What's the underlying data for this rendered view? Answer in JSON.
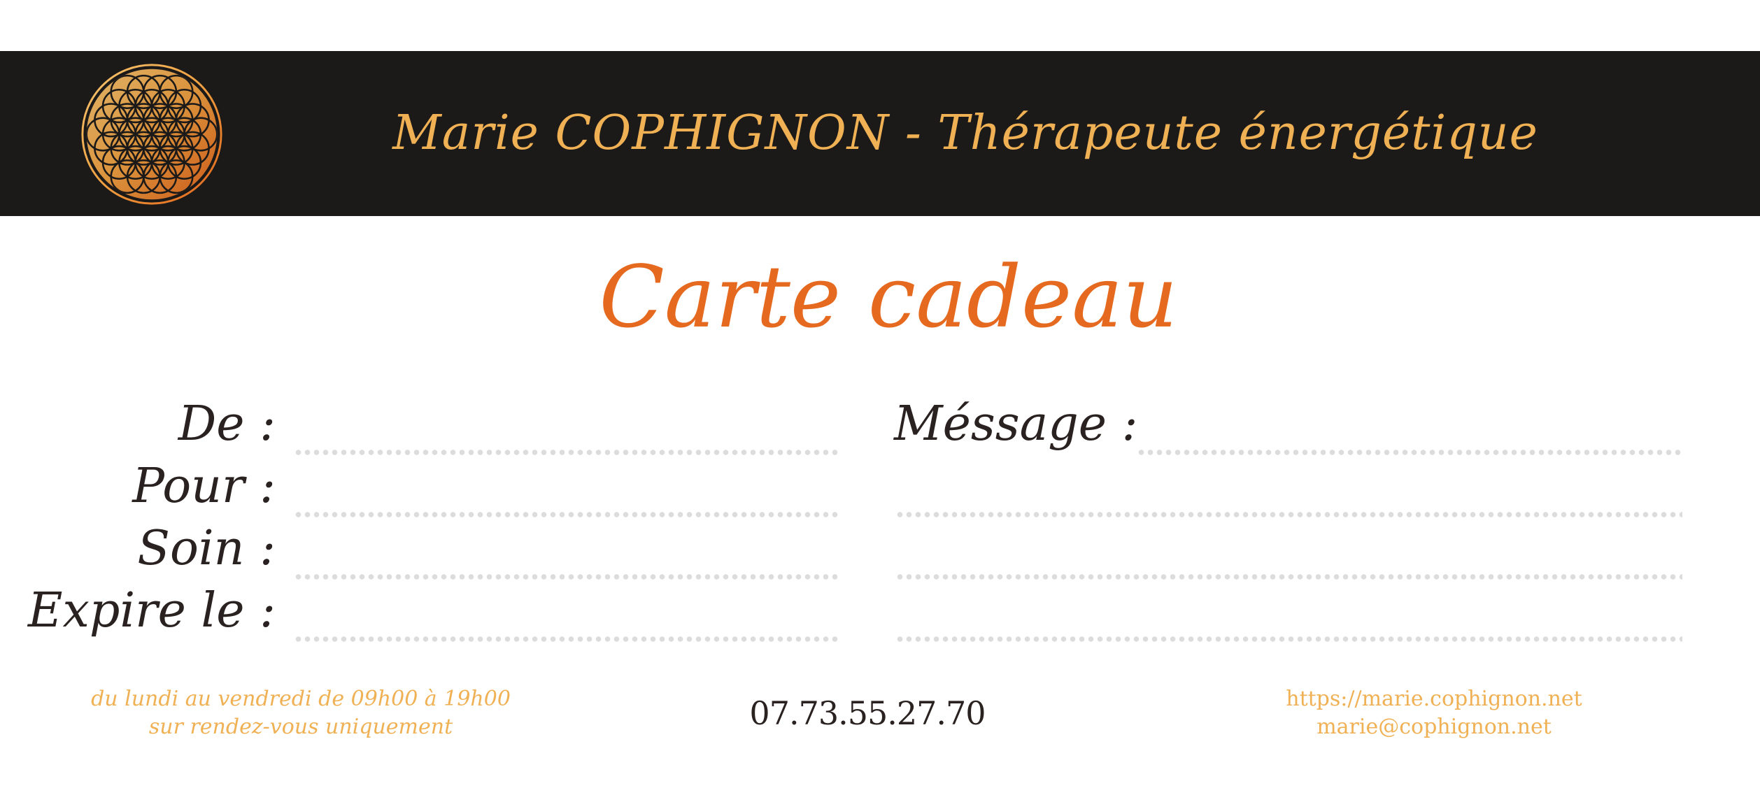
{
  "header": {
    "title": "Marie COPHIGNON - Thérapeute énergétique",
    "logo_icon": "flower-of-life-icon"
  },
  "card": {
    "title": "Carte cadeau"
  },
  "fields": {
    "from_label": "De :",
    "to_label": "Pour :",
    "treatment_label": "Soin :",
    "expires_label": "Expire le :",
    "message_label": "Méssage :"
  },
  "footer": {
    "hours_line1": "du lundi au vendredi de 09h00 à 19h00",
    "hours_line2": "sur rendez-vous uniquement",
    "phone": "07.73.55.27.70",
    "website": "https://marie.cophignon.net",
    "email": "marie@cophignon.net"
  },
  "colors": {
    "banner": "#1c1a19",
    "gold": "#f0b155",
    "orange": "#e5691e",
    "text_dark": "#2a2220",
    "dots": "#dcdcdc"
  }
}
